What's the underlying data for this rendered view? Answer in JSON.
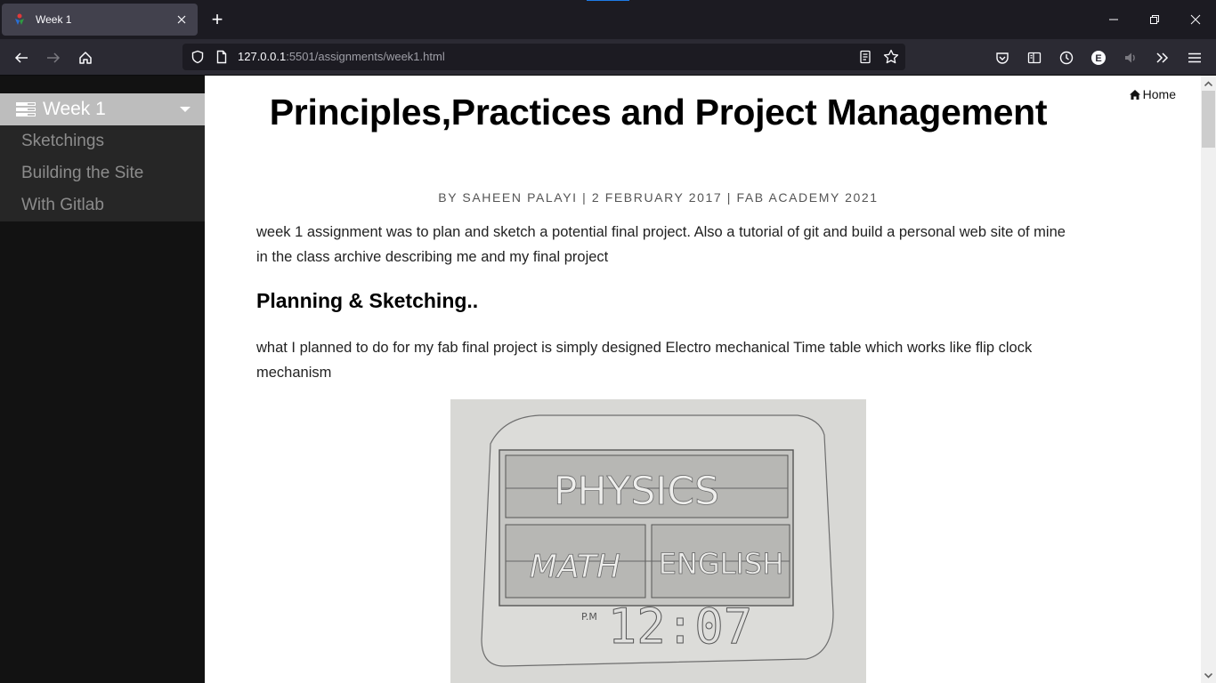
{
  "browser": {
    "tab": {
      "title": "Week 1",
      "favicon": "fab-academy-logo"
    },
    "new_tab_label": "+",
    "window_controls": [
      "minimize-icon",
      "restore-icon",
      "close-icon"
    ],
    "url": {
      "host": "127.0.0.1",
      "rest": ":5501/assignments/week1.html"
    },
    "toolbar_icons": [
      "pocket-icon",
      "sidebar-icon",
      "history-icon",
      "extension-e-icon",
      "speaker-icon",
      "overflow-chevrons-icon",
      "hamburger-menu-icon"
    ]
  },
  "sidebar": {
    "header": {
      "label": "Week 1",
      "icon": "list-icon"
    },
    "items": [
      {
        "label": "Sketchings"
      },
      {
        "label": "Building the Site"
      },
      {
        "label": "With Gitlab"
      }
    ]
  },
  "page": {
    "home_link": "Home",
    "title": "Principles,Practices and Project Management",
    "byline": "BY SAHEEN PALAYI | 2 FEBRUARY 2017 | FAB ACADEMY 2021",
    "intro": "week 1 assignment was to plan and sketch a potential final project. Also a tutorial of git and build a personal web site of mine in the class archive describing me and my final project",
    "section_heading": "Planning & Sketching..",
    "section_text": "what I planned to do for my fab final project is simply designed Electro mechanical Time table which works like flip clock mechanism",
    "sketch": {
      "top_panel": "PHYSICS",
      "bottom_left_panel": "MATH",
      "bottom_right_panel": "ENGLISH",
      "ampm": "P.M",
      "time": "12:07"
    }
  },
  "colors": {
    "tab_indicator": "#1d7ae6",
    "sidebar_bg": "#121212",
    "sidebar_header_bg": "#bdbdbd",
    "sidebar_list_bg": "#262626",
    "sidebar_item_text": "#8c8c8c"
  }
}
